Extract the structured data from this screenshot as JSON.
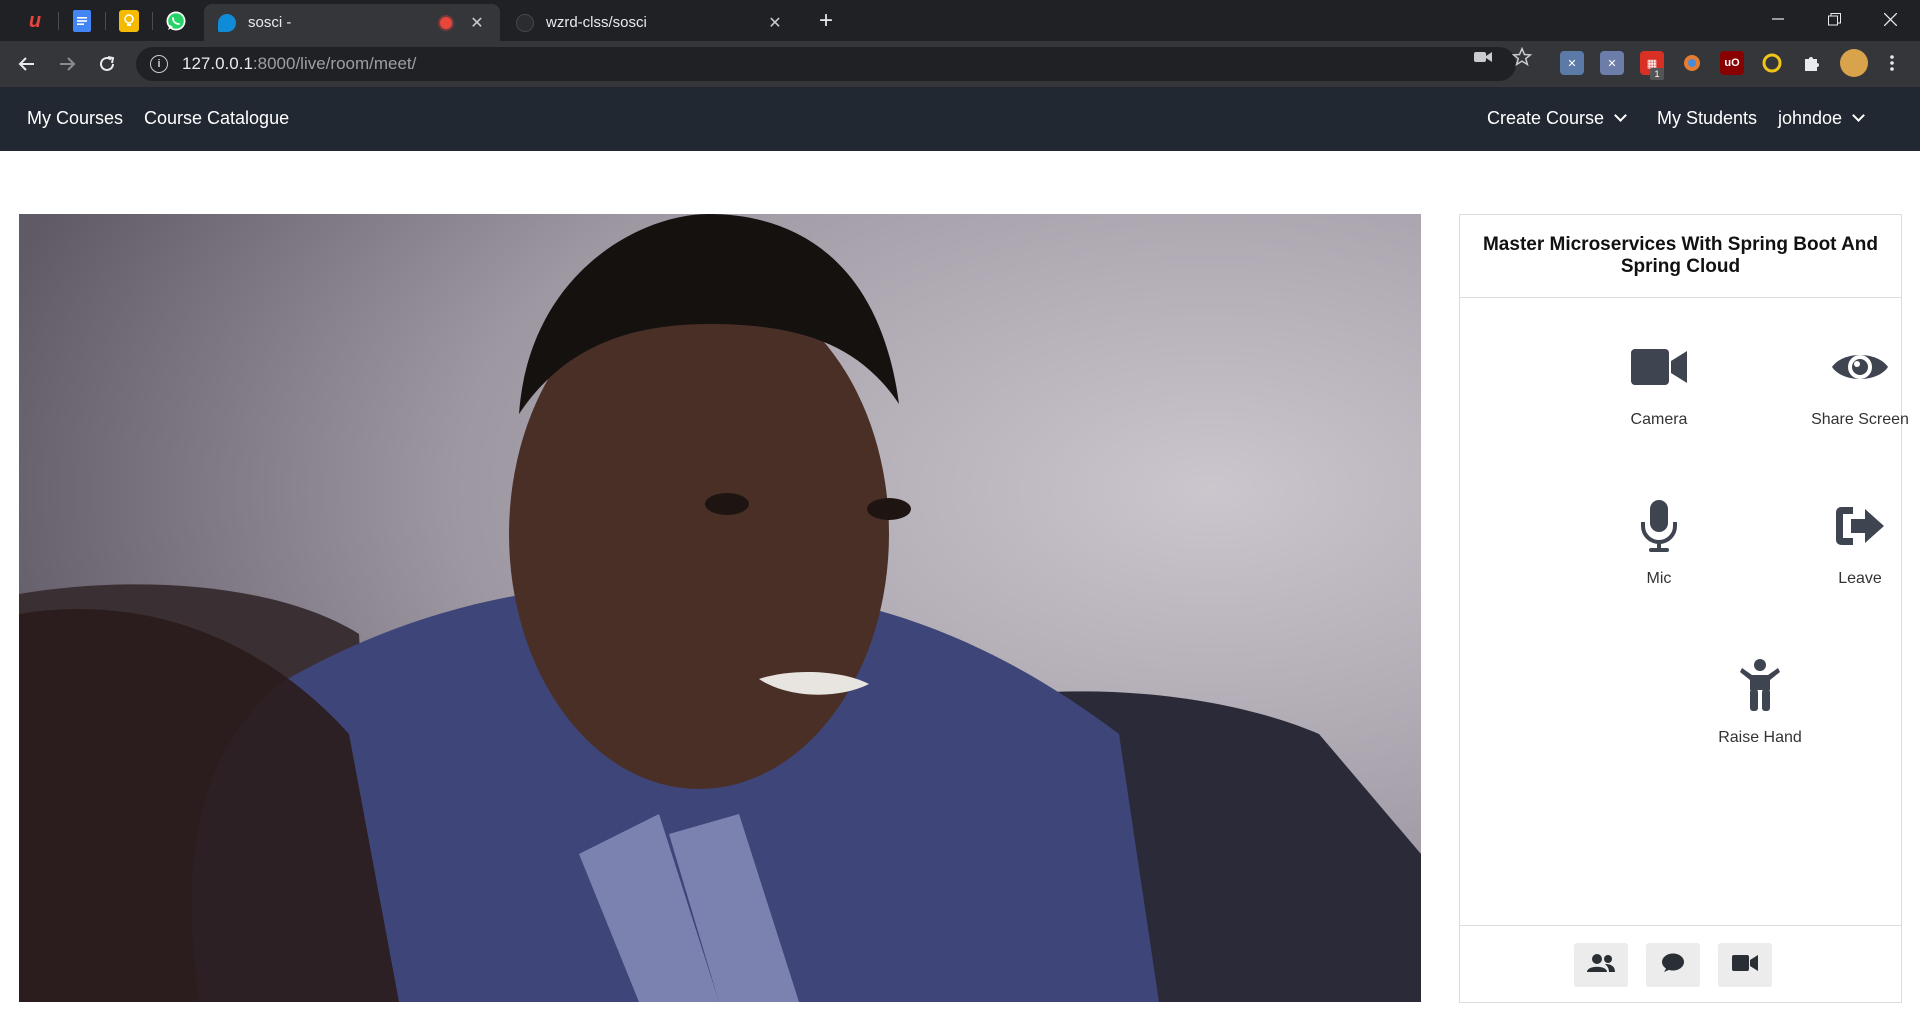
{
  "browser": {
    "tabs": [
      {
        "title": "sosci -",
        "close": "✕"
      },
      {
        "title": "wzrd-clss/sosci",
        "close": "✕"
      }
    ],
    "new_tab": "+",
    "url_host": "127.0.0.1",
    "url_rest": ":8000/live/room/meet/",
    "extension_badge": "1"
  },
  "navbar": {
    "links_left": [
      "My Courses",
      "Course Catalogue"
    ],
    "create_course": "Create Course",
    "my_students": "My Students",
    "user": "johndoe"
  },
  "panel": {
    "title": "Master Microservices With Spring Boot And Spring Cloud",
    "controls": {
      "camera": "Camera",
      "share_screen": "Share Screen",
      "mic": "Mic",
      "leave": "Leave",
      "raise_hand": "Raise Hand"
    },
    "footer_icons": [
      "users-icon",
      "chat-icon",
      "video-icon"
    ]
  },
  "colors": {
    "navbar_bg": "#222831",
    "icon": "#3f4550",
    "tab_recording": "#e8453c"
  }
}
